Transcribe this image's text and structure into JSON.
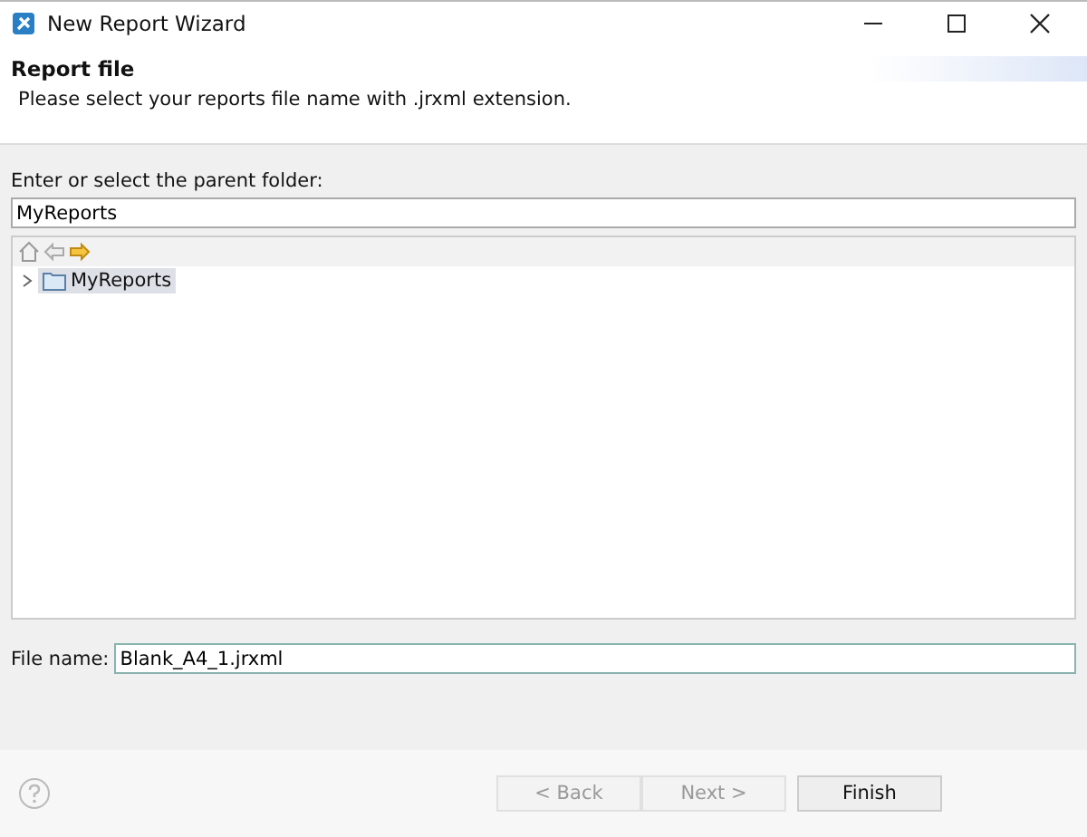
{
  "window": {
    "title": "New Report Wizard"
  },
  "header": {
    "title": "Report file",
    "description": "Please select your reports file name with .jrxml extension."
  },
  "parent_folder": {
    "label": "Enter or select the parent folder:",
    "value": "MyReports"
  },
  "tree": {
    "items": [
      {
        "label": "MyReports",
        "expanded": false,
        "selected": true
      }
    ]
  },
  "file_name": {
    "label": "File name:",
    "value": "Blank_A4_1.jrxml"
  },
  "buttons": [
    {
      "label": "< Back",
      "disabled": true
    },
    {
      "label": "Next >",
      "disabled": true
    },
    {
      "label": "Finish",
      "disabled": false
    }
  ]
}
